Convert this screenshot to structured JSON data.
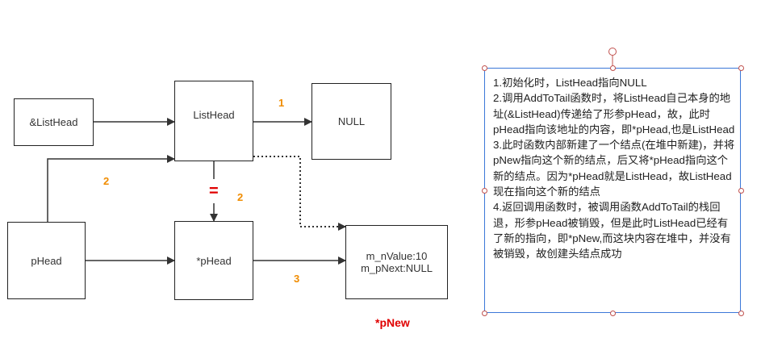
{
  "boxes": {
    "list_head_ref": "&ListHead",
    "list_head": "ListHead",
    "null_box": "NULL",
    "p_head": "pHead",
    "deref_p_head": "*pHead",
    "new_node_value": "m_nValue:10",
    "new_node_next": "m_pNext:NULL"
  },
  "step_labels": {
    "step1": "1",
    "step2_left": "2",
    "step2_right": "2",
    "step3": "3"
  },
  "equals_sign": "=",
  "p_new_label": "*pNew",
  "colors": {
    "step_number": "#f08c00",
    "equals": "#e00000",
    "p_new": "#e00000",
    "note_border": "#3c78d8",
    "handle": "#c0504d"
  },
  "note": {
    "para1": "1.初始化时，ListHead指向NULL",
    "para2": "2.调用AddToTail函数时，将ListHead自己本身的地址(&ListHead)传递给了形参pHead，故，此时pHead指向该地址的内容，即*pHead,也是ListHead",
    "para3": "3.此时函数内部新建了一个结点(在堆中新建)，并将pNew指向这个新的结点，后又将*pHead指向这个新的结点。因为*pHead就是ListHead，故ListHead现在指向这个新的结点",
    "para4": "4.返回调用函数时，被调用函数AddToTail的栈回退，形参pHead被销毁，但是此时ListHead已经有了新的指向，即*pNew,而这块内容在堆中，并没有被销毁，故创建头结点成功"
  }
}
